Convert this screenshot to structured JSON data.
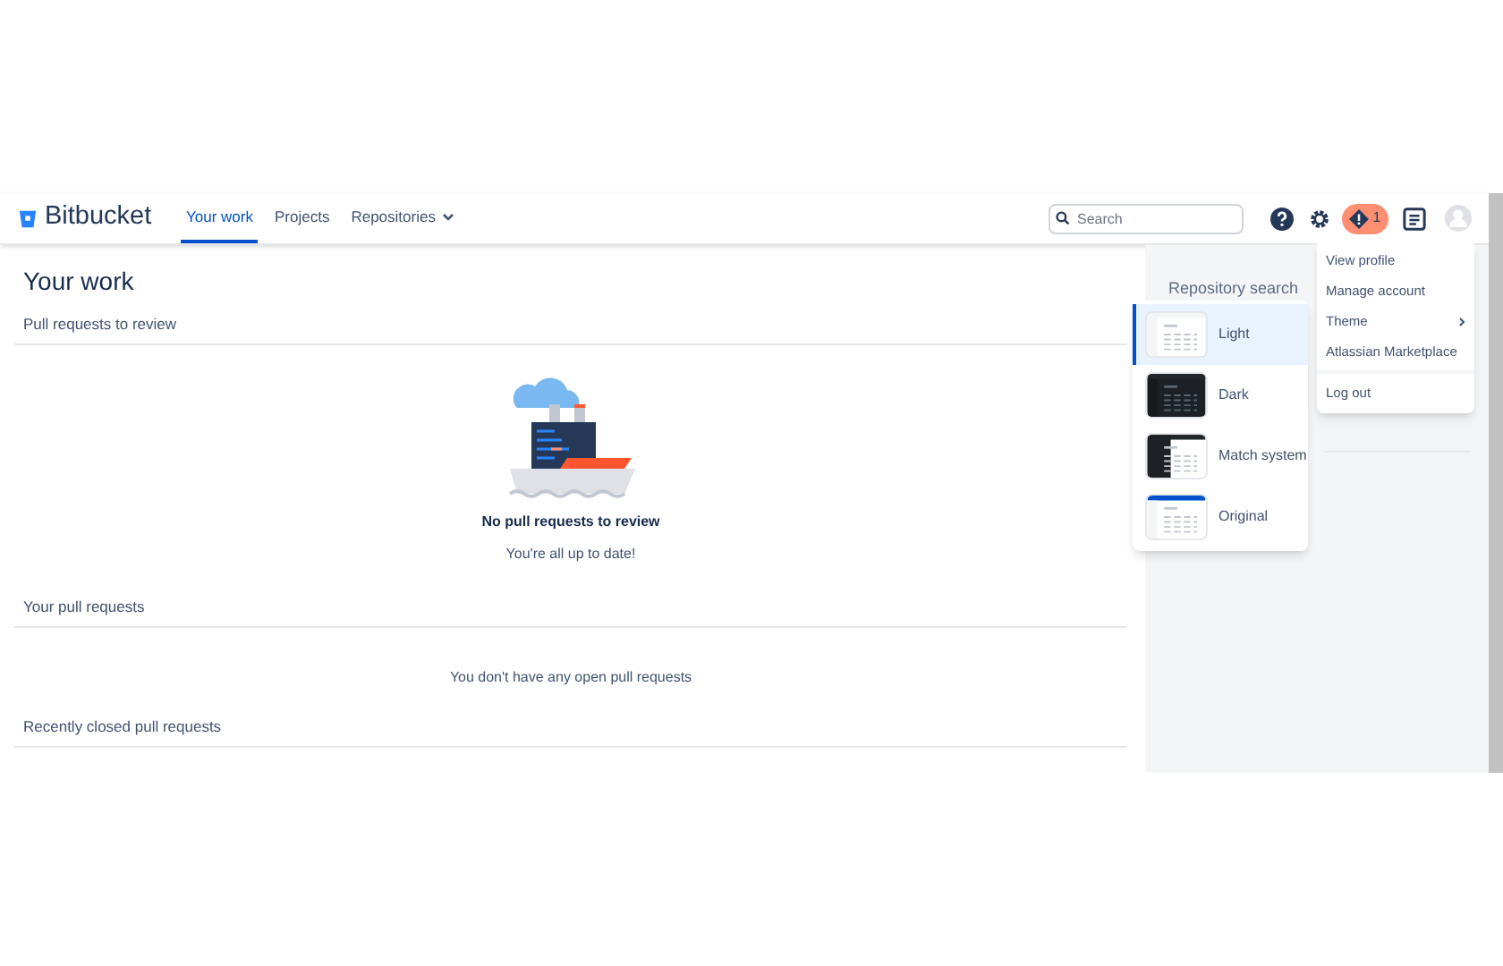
{
  "header": {
    "logo": "Bitbucket",
    "nav": [
      {
        "label": "Your work",
        "selected": true,
        "kind": "link"
      },
      {
        "label": "Projects",
        "selected": false,
        "kind": "link"
      },
      {
        "label": "Repositories",
        "selected": false,
        "kind": "dropdown"
      }
    ],
    "search": {
      "placeholder": "Search"
    },
    "notification_count": "1"
  },
  "page": {
    "title": "Your work",
    "sections": [
      {
        "heading": "Pull requests to review",
        "kind": "illustration",
        "message_title": "No pull requests to review",
        "message": "You're all up to date!"
      },
      {
        "heading": "Your pull requests",
        "kind": "text",
        "message": "You don't have any open pull requests"
      },
      {
        "heading": "Recently closed pull requests",
        "kind": "plain"
      }
    ]
  },
  "sidebar": {
    "heading": "Repository search"
  },
  "profile_menu": {
    "items": [
      {
        "label": "View profile",
        "kind": "item"
      },
      {
        "label": "Manage account",
        "kind": "item"
      },
      {
        "label": "Theme",
        "kind": "submenu"
      },
      {
        "label": "Atlassian Marketplace",
        "kind": "item"
      },
      {
        "label": "Log out",
        "kind": "separated"
      }
    ]
  },
  "theme_menu": {
    "items": [
      {
        "label": "Light",
        "selected": true,
        "kind": "light"
      },
      {
        "label": "Dark",
        "selected": false,
        "kind": "dark"
      },
      {
        "label": "Match system",
        "selected": false,
        "kind": "system"
      },
      {
        "label": "Original",
        "selected": false,
        "kind": "original"
      }
    ]
  }
}
